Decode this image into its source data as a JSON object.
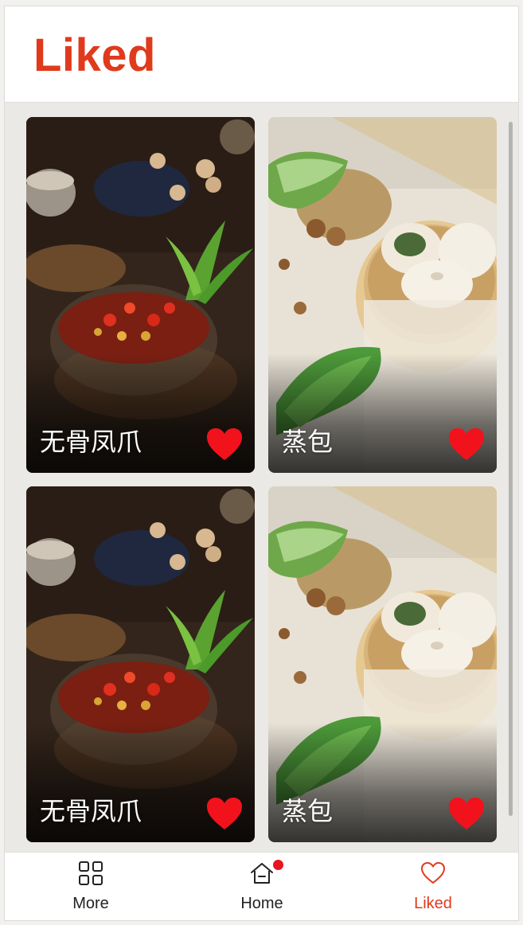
{
  "header": {
    "title": "Liked"
  },
  "colors": {
    "accent": "#e03a1c",
    "heart": "#f2121c",
    "badge": "#e8141f",
    "nav_text": "#222222"
  },
  "cards": [
    {
      "name": "无骨凤爪",
      "image": "chili-chicken-feet-photo",
      "liked": true
    },
    {
      "name": "蒸包",
      "image": "steamed-buns-photo",
      "liked": true
    },
    {
      "name": "无骨凤爪",
      "image": "chili-chicken-feet-photo",
      "liked": true
    },
    {
      "name": "蒸包",
      "image": "steamed-buns-photo",
      "liked": true
    }
  ],
  "nav": {
    "items": [
      {
        "label": "More",
        "icon": "grid-icon",
        "active": false
      },
      {
        "label": "Home",
        "icon": "home-icon",
        "active": false,
        "badge": true
      },
      {
        "label": "Liked",
        "icon": "heart-outline-icon",
        "active": true
      }
    ]
  }
}
